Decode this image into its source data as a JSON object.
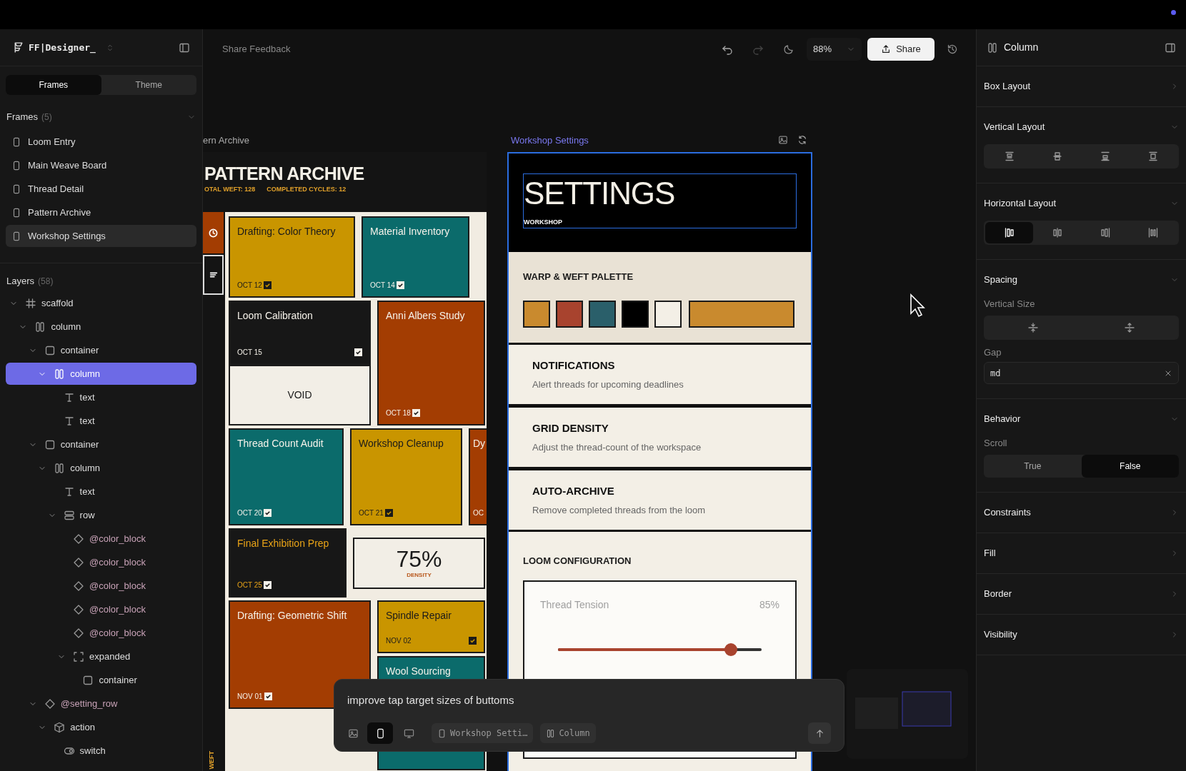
{
  "app": {
    "name": "FF|Designer_"
  },
  "left_tabs": [
    {
      "label": "Frames",
      "selected": true
    },
    {
      "label": "Theme",
      "selected": false
    }
  ],
  "frames_section": {
    "title": "Frames",
    "count": "(5)",
    "expanded": true,
    "items": [
      {
        "label": "Loom Entry",
        "selected": false
      },
      {
        "label": "Main Weave Board",
        "selected": false
      },
      {
        "label": "Thread Detail",
        "selected": false
      },
      {
        "label": "Pattern Archive",
        "selected": false
      },
      {
        "label": "Workshop Settings",
        "selected": true
      }
    ]
  },
  "layers_section": {
    "title": "Layers",
    "count": "(58)",
    "tree": [
      {
        "label": "scaffold",
        "kind": "scaffold",
        "expanded": true,
        "selected": false,
        "children": [
          {
            "label": "column",
            "kind": "column",
            "expanded": true,
            "selected": false,
            "children": [
              {
                "label": "container",
                "kind": "container",
                "expanded": true,
                "selected": false,
                "children": [
                  {
                    "label": "column",
                    "kind": "column",
                    "expanded": true,
                    "selected": true,
                    "children": [
                      {
                        "label": "text",
                        "kind": "text",
                        "selected": false
                      },
                      {
                        "label": "text",
                        "kind": "text",
                        "selected": false
                      }
                    ]
                  }
                ]
              },
              {
                "label": "container",
                "kind": "container",
                "expanded": true,
                "selected": false,
                "children": [
                  {
                    "label": "column",
                    "kind": "column",
                    "expanded": true,
                    "selected": false,
                    "children": [
                      {
                        "label": "text",
                        "kind": "text",
                        "selected": false
                      },
                      {
                        "label": "row",
                        "kind": "row",
                        "expanded": true,
                        "selected": false,
                        "children": [
                          {
                            "label": "@color_block",
                            "kind": "component",
                            "selected": false
                          },
                          {
                            "label": "@color_block",
                            "kind": "component",
                            "selected": false
                          },
                          {
                            "label": "@color_block",
                            "kind": "component",
                            "selected": false
                          },
                          {
                            "label": "@color_block",
                            "kind": "component",
                            "selected": false
                          },
                          {
                            "label": "@color_block",
                            "kind": "component",
                            "selected": false
                          },
                          {
                            "label": "expanded",
                            "kind": "expanded",
                            "expanded": true,
                            "selected": false,
                            "children": [
                              {
                                "label": "container",
                                "kind": "container",
                                "selected": false
                              }
                            ]
                          }
                        ]
                      }
                    ]
                  }
                ]
              },
              {
                "label": "@setting_row",
                "kind": "component",
                "expanded": true,
                "selected": false,
                "children": [
                  {
                    "label": "action",
                    "kind": "action",
                    "expanded": true,
                    "selected": false,
                    "children": [
                      {
                        "label": "switch",
                        "kind": "switch",
                        "selected": false
                      }
                    ]
                  }
                ]
              }
            ]
          }
        ]
      }
    ]
  },
  "toolbar": {
    "feedback": "Share Feedback",
    "history": [
      {
        "kind": "undo",
        "disabled": false
      },
      {
        "kind": "redo",
        "disabled": true
      }
    ],
    "zoom": "88%",
    "share": "Share"
  },
  "archive_frame": {
    "label": "ern Archive",
    "selected": false,
    "title": "PATTERN ARCHIVE",
    "stats": [
      "OTAL WEFT: 128",
      "COMPLETED CYCLES: 12"
    ],
    "side_label": "WEFT",
    "cards": [
      {
        "kind": "task",
        "title": "Drafting: Color Theory",
        "date": "OCT 12",
        "done": true,
        "color": "#c99500"
      },
      {
        "kind": "task",
        "title": "Material Inventory",
        "date": "OCT 14",
        "done": true,
        "color": "#0b6b6b"
      },
      {
        "kind": "task",
        "title": "Loom Calibration",
        "date": "OCT 15",
        "done": true,
        "color": "#171717"
      },
      {
        "kind": "void",
        "label": "VOID",
        "color": "#f2eee6"
      },
      {
        "kind": "task",
        "title": "Anni Albers Study",
        "date": "OCT 18",
        "done": true,
        "color": "#a33d02"
      },
      {
        "kind": "task",
        "title": "Thread Count Audit",
        "date": "OCT 20",
        "done": true,
        "color": "#0b6b6b"
      },
      {
        "kind": "task",
        "title": "Workshop Cleanup",
        "date": "OCT 21",
        "done": true,
        "color": "#c99500"
      },
      {
        "kind": "task",
        "title": "Dy",
        "date": "OC",
        "color": "#a33d02"
      },
      {
        "kind": "milestone",
        "title": "Final Exhibition Prep",
        "date": "OCT 25",
        "done": true,
        "color": "#171717"
      },
      {
        "kind": "metric",
        "value": "75%",
        "label": "DENSITY",
        "color": "#f2eee6"
      },
      {
        "kind": "task",
        "title": "Drafting: Geometric Shift",
        "date": "NOV 01",
        "done": true,
        "color": "#a33d02"
      },
      {
        "kind": "task",
        "title": "Spindle Repair",
        "date": "NOV 02",
        "done": true,
        "color": "#c99500"
      },
      {
        "kind": "task",
        "title": "Wool Sourcing",
        "color": "#0b6b6b"
      }
    ]
  },
  "settings_frame": {
    "label": "Workshop Settings",
    "selected": true,
    "title": "SETTINGS",
    "subtitle": "WORKSHOP",
    "palette": {
      "title": "WARP & WEFT PALETTE",
      "swatches": [
        {
          "kind": "square",
          "color": "#c98a2e"
        },
        {
          "kind": "square",
          "color": "#a8432e"
        },
        {
          "kind": "square",
          "color": "#2a5f6a"
        },
        {
          "kind": "square",
          "color": "#000000"
        },
        {
          "kind": "square",
          "color": "#f3efe6"
        },
        {
          "kind": "wide",
          "color": "#c98a2e"
        }
      ]
    },
    "rows": [
      {
        "title": "NOTIFICATIONS",
        "description": "Alert threads for upcoming deadlines"
      },
      {
        "title": "GRID DENSITY",
        "description": "Adjust the thread-count of the workspace"
      },
      {
        "title": "AUTO-ARCHIVE",
        "description": "Remove completed threads from the loom"
      }
    ],
    "loom": {
      "title": "LOOM CONFIGURATION",
      "slider": {
        "label": "Thread Tension",
        "reading": "85%",
        "level": 0.85
      }
    }
  },
  "prompt": {
    "text": "improve tap target sizes of buttoms",
    "devices": [
      {
        "kind": "phone",
        "selected": true
      },
      {
        "kind": "desktop",
        "selected": false
      }
    ],
    "chips": [
      {
        "kind": "frame",
        "label": "Workshop Setti…"
      },
      {
        "kind": "column",
        "label": "Column"
      }
    ]
  },
  "inspector": {
    "title": "Column",
    "sections": [
      {
        "title": "Box Layout",
        "kind": "plain",
        "expanded": false
      },
      {
        "title": "Vertical Layout",
        "kind": "vertical_align",
        "expanded": true,
        "options": [
          {
            "selected": false
          },
          {
            "selected": false
          },
          {
            "selected": false
          },
          {
            "selected": false
          }
        ]
      },
      {
        "title": "Horizontal Layout",
        "kind": "horizontal_align",
        "expanded": true,
        "options": [
          {
            "selected": true
          },
          {
            "selected": false
          },
          {
            "selected": false
          },
          {
            "selected": false
          }
        ]
      },
      {
        "title": "Spacing",
        "kind": "spacing",
        "expanded": true,
        "size_label": "Vertical Size",
        "size_options": [
          {
            "selected": false
          },
          {
            "selected": false
          }
        ],
        "gap_label": "Gap",
        "gap_value": "md"
      },
      {
        "title": "Behavior",
        "kind": "behavior",
        "expanded": true,
        "scroll_label": "Scroll",
        "options": [
          {
            "label": "True",
            "selected": false
          },
          {
            "label": "False",
            "selected": true
          }
        ]
      },
      {
        "title": "Constraints",
        "kind": "plain",
        "expanded": false
      },
      {
        "title": "Fill",
        "kind": "plain",
        "expanded": false
      },
      {
        "title": "Border",
        "kind": "plain",
        "expanded": false
      },
      {
        "title": "Visibility",
        "kind": "plain",
        "expanded": false
      }
    ]
  }
}
